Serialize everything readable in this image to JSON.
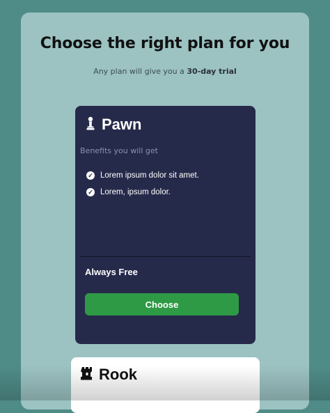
{
  "header": {
    "title": "Choose the right plan for you",
    "subtitle_prefix": "Any plan will give you a ",
    "subtitle_bold": "30-day trial"
  },
  "plans": [
    {
      "name": "Pawn",
      "icon": "chess-pawn-icon",
      "benefits_label": "Benefits you will get",
      "benefits": [
        "Lorem ipsum dolor sit amet.",
        "Lorem, ipsum dolor."
      ],
      "price_label": "Always Free",
      "button_label": "Choose"
    },
    {
      "name": "Rook",
      "icon": "chess-rook-icon"
    }
  ],
  "colors": {
    "background": "#4f8c88",
    "panel": "#9cc2c2",
    "card_dark": "#262a4a",
    "button": "#2f9a45"
  }
}
